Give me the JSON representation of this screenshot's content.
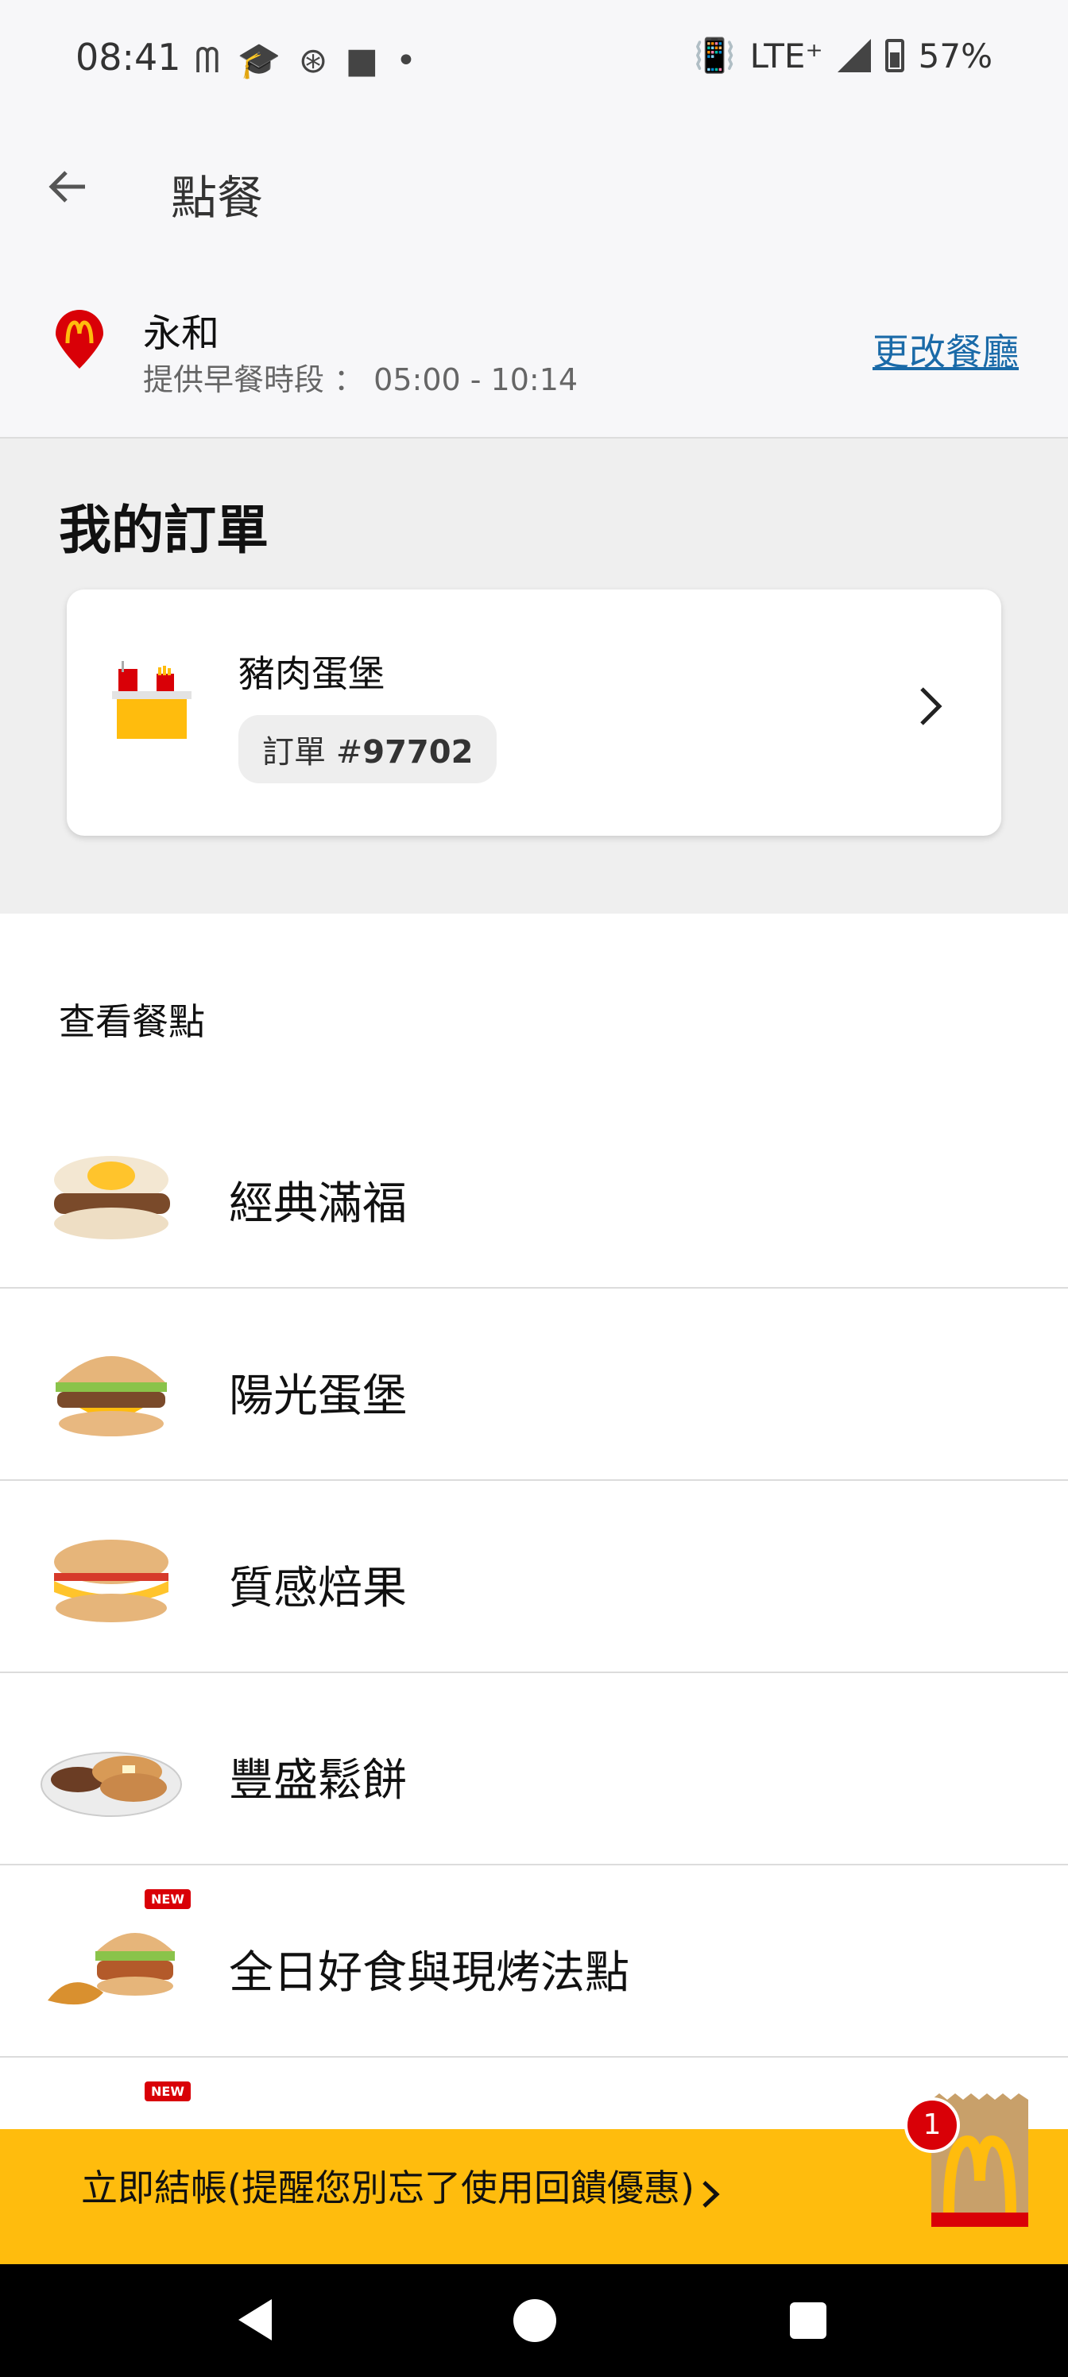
{
  "status_bar": {
    "time": "08:41",
    "network": "LTE⁺",
    "battery": "57%"
  },
  "app_bar": {
    "title": "點餐"
  },
  "store": {
    "name": "永和",
    "hours": "提供早餐時段 ： 05:00 - 10:14",
    "change_label": "更改餐廳"
  },
  "orders": {
    "title": "我的訂單",
    "card": {
      "name": "豬肉蛋堡",
      "order_prefix": "訂單 #",
      "order_number": "97702"
    }
  },
  "menu": {
    "heading": "查看餐點",
    "items": [
      {
        "label": "經典滿福",
        "new": false
      },
      {
        "label": "陽光蛋堡",
        "new": false
      },
      {
        "label": "質感焙果",
        "new": false
      },
      {
        "label": "豐盛鬆餅",
        "new": false
      },
      {
        "label": "全日好食與現烤法點",
        "new": true
      },
      {
        "label": "",
        "new": true
      }
    ],
    "new_badge": "NEW"
  },
  "checkout": {
    "label": "立即結帳(提醒您別忘了使用回饋優惠)",
    "bag_count": "1"
  },
  "colors": {
    "accent_yellow": "#ffbc0d",
    "brand_red": "#d90007",
    "link_blue": "#1a6aa8"
  }
}
